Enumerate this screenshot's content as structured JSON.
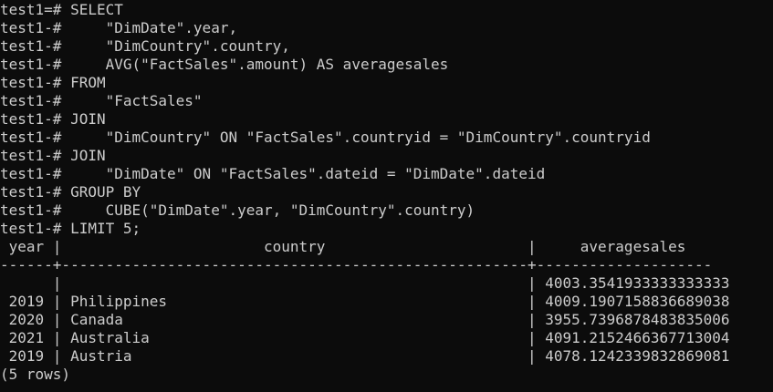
{
  "session": {
    "prompt_first": "test1=# ",
    "prompt_cont": "test1-# "
  },
  "query_lines": [
    {
      "prompt": "test1=# ",
      "text": "SELECT"
    },
    {
      "prompt": "test1-# ",
      "text": "    \"DimDate\".year,"
    },
    {
      "prompt": "test1-# ",
      "text": "    \"DimCountry\".country,"
    },
    {
      "prompt": "test1-# ",
      "text": "    AVG(\"FactSales\".amount) AS averagesales"
    },
    {
      "prompt": "test1-# ",
      "text": "FROM"
    },
    {
      "prompt": "test1-# ",
      "text": "    \"FactSales\""
    },
    {
      "prompt": "test1-# ",
      "text": "JOIN"
    },
    {
      "prompt": "test1-# ",
      "text": "    \"DimCountry\" ON \"FactSales\".countryid = \"DimCountry\".countryid"
    },
    {
      "prompt": "test1-# ",
      "text": "JOIN"
    },
    {
      "prompt": "test1-# ",
      "text": "    \"DimDate\" ON \"FactSales\".dateid = \"DimDate\".dateid"
    },
    {
      "prompt": "test1-# ",
      "text": "GROUP BY"
    },
    {
      "prompt": "test1-# ",
      "text": "    CUBE(\"DimDate\".year, \"DimCountry\".country)"
    },
    {
      "prompt": "test1-# ",
      "text": "LIMIT 5;"
    }
  ],
  "result": {
    "header_line": " year |                       country                       |     averagesales",
    "separator_line": "------+-----------------------------------------------------+--------------------",
    "rows": [
      "      |                                                     | 4003.3541933333333333",
      " 2019 | Philippines                                         | 4009.1907158836689038",
      " 2020 | Canada                                              | 3955.7396878483835006",
      " 2021 | Australia                                           | 4091.2152466367713004",
      " 2019 | Austria                                             | 4078.1242339832869081"
    ],
    "footer": "(5 rows)"
  },
  "table": {
    "columns": [
      "year",
      "country",
      "averagesales"
    ],
    "cells": [
      [
        "",
        "",
        "4003.3541933333333333"
      ],
      [
        "2019",
        "Philippines",
        "4009.1907158836689038"
      ],
      [
        "2020",
        "Canada",
        "3955.7396878483835006"
      ],
      [
        "2021",
        "Australia",
        "4091.2152466367713004"
      ],
      [
        "2019",
        "Austria",
        "4078.1242339832869081"
      ]
    ]
  }
}
